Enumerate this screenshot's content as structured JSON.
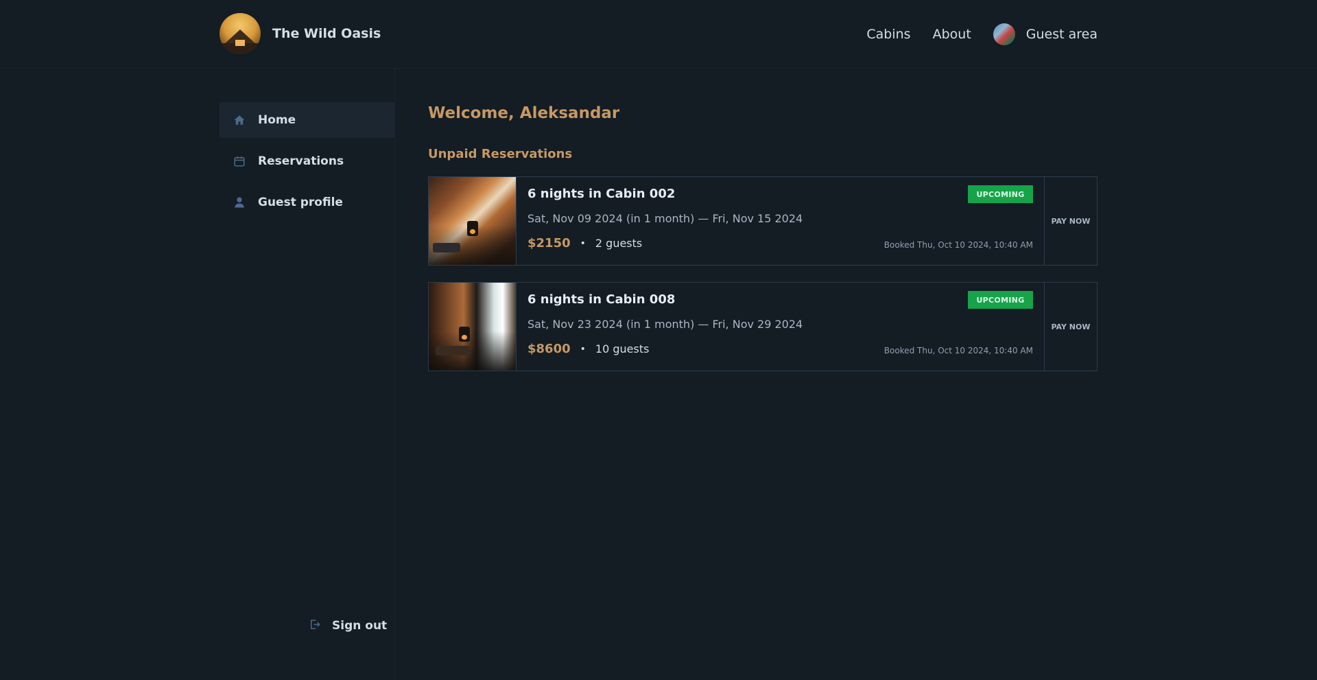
{
  "header": {
    "logo_alt": "The Wild Oasis logo",
    "brand": "The Wild Oasis",
    "nav": [
      {
        "label": "Cabins"
      },
      {
        "label": "About"
      },
      {
        "label": "Guest area"
      }
    ]
  },
  "sidebar": {
    "items": [
      {
        "label": "Home",
        "icon": "home-icon",
        "active": true
      },
      {
        "label": "Reservations",
        "icon": "calendar-icon",
        "active": false
      },
      {
        "label": "Guest profile",
        "icon": "user-icon",
        "active": false
      }
    ],
    "sign_out": "Sign out"
  },
  "main": {
    "welcome": "Welcome, Aleksandar",
    "section_title": "Unpaid Reservations",
    "reservations": [
      {
        "title": "6 nights in Cabin 002",
        "dates": "Sat, Nov 09 2024 (in 1 month) — Fri, Nov 15 2024",
        "price": "$2150",
        "separator": "•",
        "guests": "2 guests",
        "status": "UPCOMING",
        "booked": "Booked Thu, Oct 10 2024, 10:40 AM",
        "action": "PAY NOW"
      },
      {
        "title": "6 nights in Cabin 008",
        "dates": "Sat, Nov 23 2024 (in 1 month) — Fri, Nov 29 2024",
        "price": "$8600",
        "separator": "•",
        "guests": "10 guests",
        "status": "UPCOMING",
        "booked": "Booked Thu, Oct 10 2024, 10:40 AM",
        "action": "PAY NOW"
      }
    ]
  },
  "colors": {
    "background": "#141c24",
    "accent": "#c69963",
    "badge_green": "#16a34a",
    "border": "#2c3d4f"
  }
}
